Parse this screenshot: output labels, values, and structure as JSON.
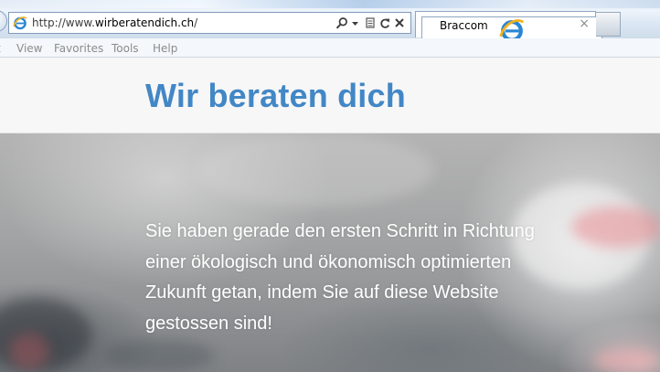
{
  "browser": {
    "address_prefix": "http://www.",
    "address_domain": "wirberatendich.ch",
    "address_suffix": "/",
    "tab_title": "Braccom",
    "tab_close": "×",
    "menu": [
      "View",
      "Favorites",
      "Tools",
      "Help"
    ]
  },
  "site": {
    "title": "Wir beraten dich",
    "title_color": "#4287c6"
  },
  "hero": {
    "lines": [
      "Sie haben gerade den ersten Schritt in Richtung",
      "einer ökologisch und ökonomisch optimierten",
      "Zukunft getan, indem Sie auf diese Website",
      "gestossen sind!"
    ]
  },
  "icons": {
    "address_icon": "ie-icon",
    "tab_icon": "ie-icon",
    "search": "search-icon",
    "dropdown": "chevron-down-icon",
    "compat": "compatibility-view-icon",
    "refresh": "refresh-icon",
    "stop": "stop-icon"
  }
}
